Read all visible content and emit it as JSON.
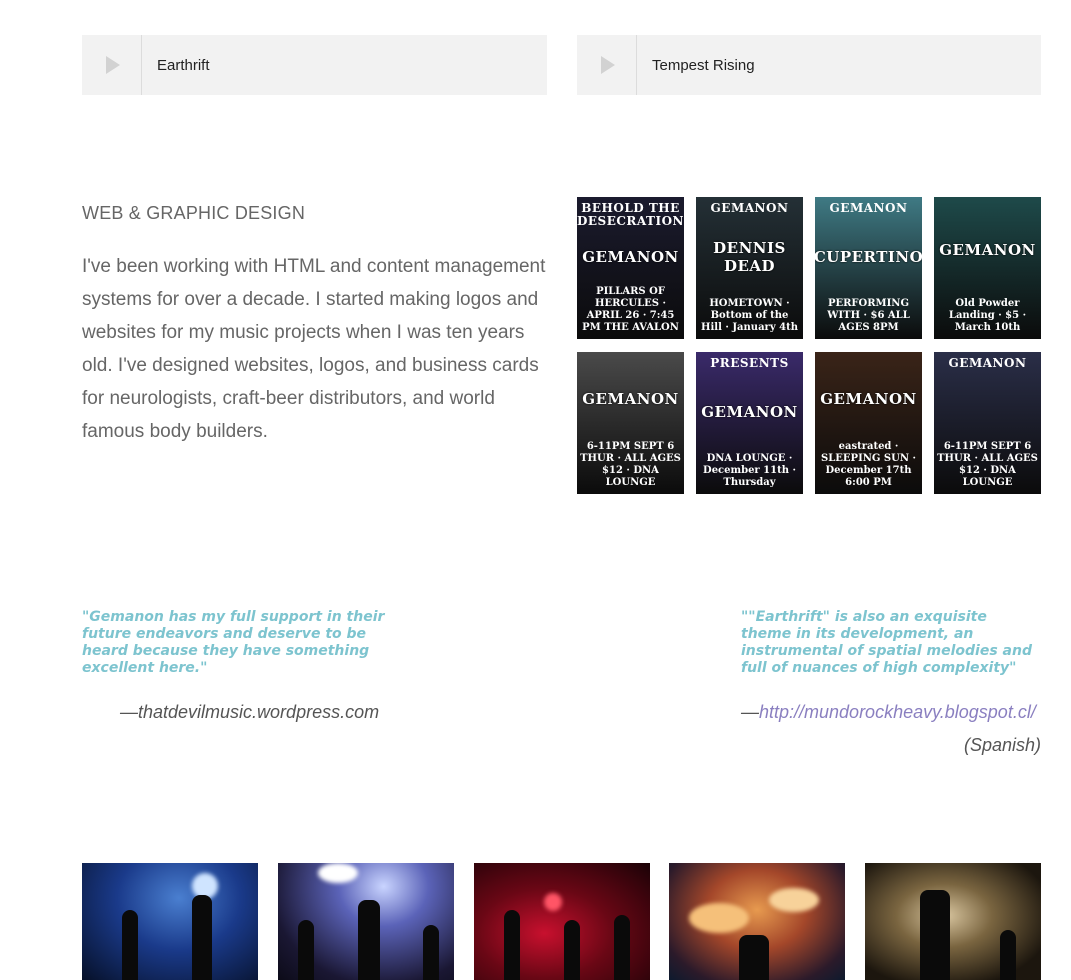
{
  "players": [
    {
      "track": "Earthrift"
    },
    {
      "track": "Tempest Rising"
    }
  ],
  "design": {
    "title": "WEB & GRAPHIC DESIGN",
    "body": "I've been working with HTML and content management systems for over a decade. I started making logos and websites for my music projects when I was ten years old. I've designed websites, logos, and business cards for neurologists, craft-beer distributors, and world famous body builders."
  },
  "gallery": [
    {
      "top": "BEHOLD THE DESECRATION",
      "mid": "GEMANON",
      "bot": "PILLARS OF HERCULES · APRIL 26 · 7:45 PM THE AVALON",
      "bg": "#1b1b2e"
    },
    {
      "top": "GEMANON",
      "mid": "DENNIS DEAD",
      "bot": "HOMETOWN · Bottom of the Hill · January 4th",
      "bg": "#243036"
    },
    {
      "top": "GEMANON",
      "mid": "CUPERTINO",
      "bot": "PERFORMING WITH · $6 ALL AGES 8PM",
      "bg": "#3f7a84"
    },
    {
      "top": "",
      "mid": "GEMANON",
      "bot": "Old Powder Landing · $5 · March 10th",
      "bg": "#1e4a4a"
    },
    {
      "top": "",
      "mid": "GEMANON",
      "bot": "6-11PM SEPT 6 THUR · ALL AGES $12 · DNA LOUNGE",
      "bg": "#4a4a4a"
    },
    {
      "top": "PRESENTS",
      "mid": "GEMANON",
      "bot": "DNA LOUNGE · December 11th · Thursday",
      "bg": "#3a2a6a"
    },
    {
      "top": "",
      "mid": "GEMANON",
      "bot": "eastrated · SLEEPING SUN · December 17th 6:00 PM",
      "bg": "#3a2418"
    },
    {
      "top": "GEMANON",
      "mid": "",
      "bot": "6-11PM SEPT 6 THUR · ALL AGES $12 · DNA LOUNGE",
      "bg": "#2a2e48"
    }
  ],
  "quotes": [
    {
      "text": "\"Gemanon has my full support in their future endeavors and deserve to be heard because they have something excellent here.\"",
      "attribution": "—thatdevilmusic.wordpress.com"
    },
    {
      "text": "\"\"Earthrift\" is also an exquisite theme in its development, an instrumental of spatial melodies and full of nuances of high complexity\"",
      "dash": "—",
      "link": "http://mundorockheavy.blogspot.cl/",
      "note": "(Spanish)"
    }
  ],
  "colors": {
    "quote": "#7dc4cf",
    "link": "#8a7fc0",
    "player_bg": "#f2f2f2"
  },
  "photos": [
    {
      "alt": "live-photo-1"
    },
    {
      "alt": "live-photo-2"
    },
    {
      "alt": "live-photo-3"
    },
    {
      "alt": "live-photo-4"
    },
    {
      "alt": "live-photo-5"
    }
  ]
}
